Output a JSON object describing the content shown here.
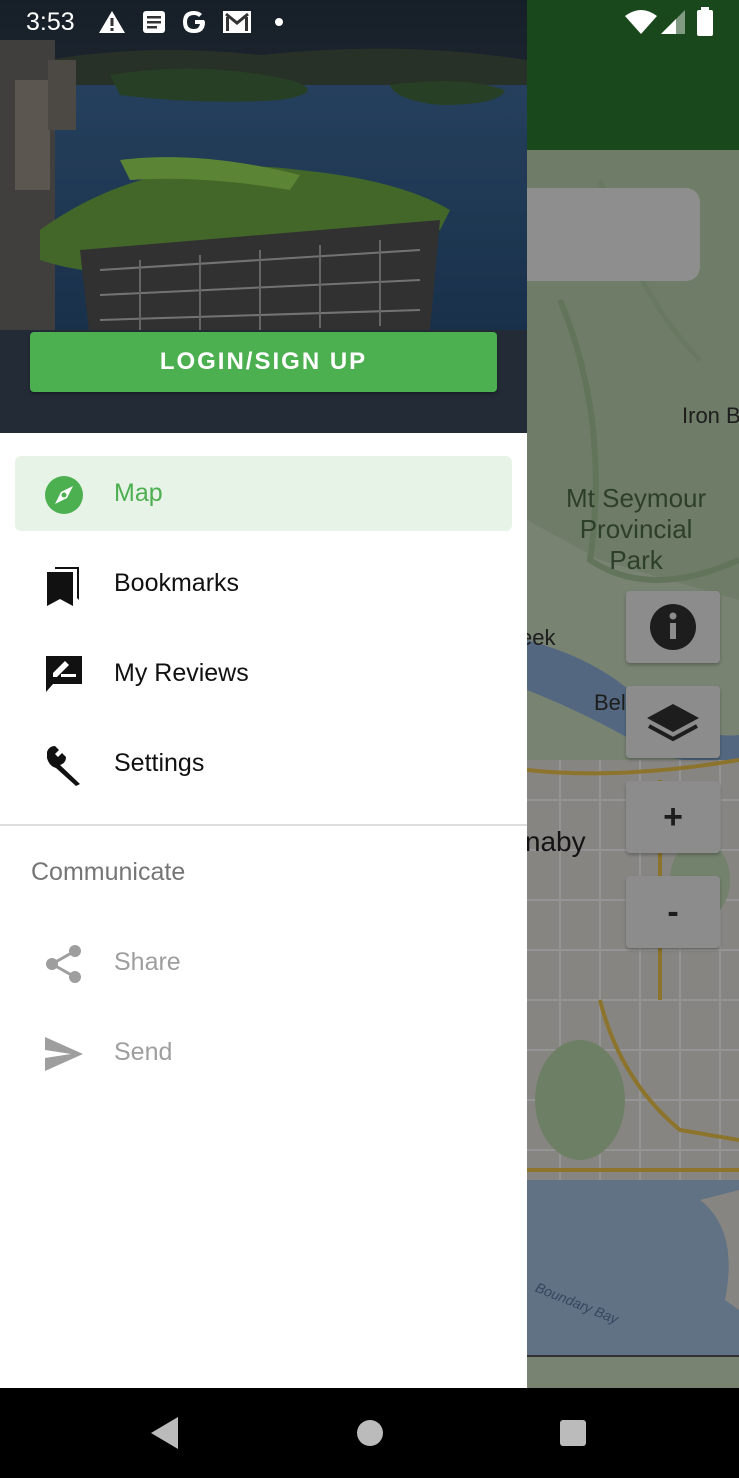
{
  "status_bar": {
    "time": "3:53",
    "icons": [
      "warning-icon",
      "news-icon",
      "google-icon",
      "gmail-icon",
      "dot-icon",
      "wifi-icon",
      "signal-icon",
      "battery-icon"
    ]
  },
  "drawer": {
    "login_label": "LOGIN/SIGN UP",
    "items": [
      {
        "label": "Map",
        "icon": "compass-icon",
        "selected": true
      },
      {
        "label": "Bookmarks",
        "icon": "bookmarks-icon"
      },
      {
        "label": "My Reviews",
        "icon": "rate-review-icon"
      },
      {
        "label": "Settings",
        "icon": "wrench-icon"
      }
    ],
    "section_title": "Communicate",
    "section_items": [
      {
        "label": "Share",
        "icon": "share-icon"
      },
      {
        "label": "Send",
        "icon": "send-icon"
      }
    ]
  },
  "map": {
    "park_label_line1": "Mt Seymour",
    "park_label_line2": "Provincial",
    "park_label_line3": "Park",
    "iron_label": "Iron B",
    "creek_label": "eek",
    "bel_label": "Bel",
    "burnaby_label": "urnaby",
    "bay_label": "Boundary Bay",
    "zoom_in_label": "+",
    "zoom_out_label": "-"
  },
  "colors": {
    "accent": "#4caf50",
    "appbar": "#2e7d32",
    "selected_bg": "#e8f3e7"
  }
}
